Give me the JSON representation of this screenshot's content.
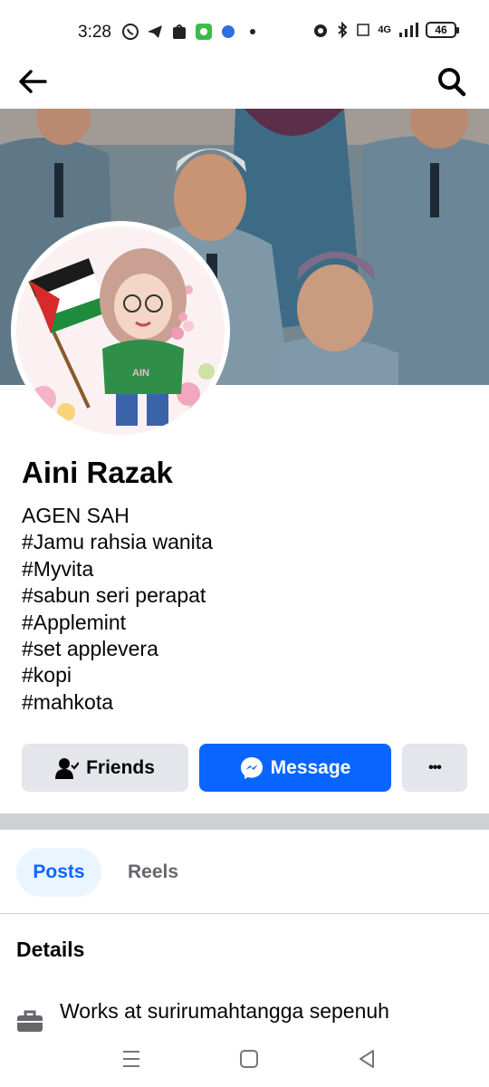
{
  "status_bar": {
    "time": "3:28",
    "left_icons": [
      "whatsapp-icon",
      "telegram-icon",
      "shopee-icon",
      "app-icon",
      "messenger-icon",
      "dot-icon"
    ],
    "network_label": "4G",
    "battery": "46"
  },
  "app_bar": {
    "back_icon": "back-arrow-icon",
    "search_icon": "search-icon"
  },
  "profile": {
    "name": "Aini Razak",
    "avatar_label": "AIN",
    "bio_lines": [
      "AGEN SAH",
      "#Jamu rahsia wanita",
      "#Myvita",
      "#sabun seri perapat",
      "#Applemint",
      "#set applevera",
      "#kopi",
      "#mahkota"
    ]
  },
  "actions": {
    "friends_label": "Friends",
    "message_label": "Message",
    "more_label": "•••"
  },
  "tabs": [
    {
      "label": "Posts",
      "active": true
    },
    {
      "label": "Reels",
      "active": false
    }
  ],
  "details": {
    "title": "Details",
    "items": [
      {
        "icon": "briefcase-icon",
        "text": "Works at surirumahtangga sepenuh"
      }
    ]
  },
  "colors": {
    "accent": "#0866ff",
    "button_grey": "#e4e6eb",
    "tab_active_bg": "#ebf5ff"
  }
}
